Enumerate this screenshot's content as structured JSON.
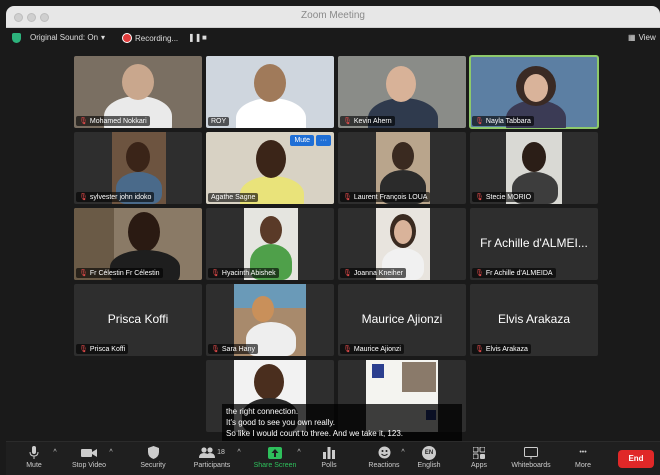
{
  "window": {
    "title": "Zoom Meeting"
  },
  "statusbar": {
    "original_sound": "Original Sound: On",
    "recording": "Recording...",
    "view": "View"
  },
  "tiles": [
    {
      "name": "Mohamed Nokkari",
      "muted": true
    },
    {
      "name": "ROY",
      "muted": false
    },
    {
      "name": "Kevin Ahern",
      "muted": true
    },
    {
      "name": "Nayla Tabbara",
      "muted": true
    },
    {
      "name": "sylvester john idoko",
      "muted": true
    },
    {
      "name": "Agathe Sagne",
      "muted": false
    },
    {
      "name": "Laurent François LOUA",
      "muted": true
    },
    {
      "name": "Stecie MORIO",
      "muted": true
    },
    {
      "name": "Fr Célestin Fr Célestin",
      "muted": true
    },
    {
      "name": "Hyacinth Abishek",
      "muted": true
    },
    {
      "name": "Joanna Kneiher",
      "muted": true
    },
    {
      "name": "Fr Achille d'ALMEIDA",
      "muted": true,
      "big": "Fr Achille d'ALMEI..."
    },
    {
      "name": "Prisca Koffi",
      "muted": true,
      "big": "Prisca Koffi"
    },
    {
      "name": "Sara Hany",
      "muted": true
    },
    {
      "name": "Maurice Ajionzi",
      "muted": true,
      "big": "Maurice Ajionzi"
    },
    {
      "name": "Elvis Arakaza",
      "muted": true,
      "big": "Elvis Arakaza"
    }
  ],
  "hover": {
    "mute": "Mute",
    "more": "···"
  },
  "caption": {
    "line1": "the right connection.",
    "line2": "It's good to see you own really.",
    "line3": "So like I would count to three. And we take it, 123."
  },
  "toolbar": {
    "mute": "Mute",
    "stop_video": "Stop Video",
    "security": "Security",
    "participants": "Participants",
    "participants_count": "18",
    "share": "Share Screen",
    "polls": "Polls",
    "reactions": "Reactions",
    "english": "English",
    "english_badge": "EN",
    "apps": "Apps",
    "whiteboards": "Whiteboards",
    "more": "More",
    "end": "End"
  }
}
